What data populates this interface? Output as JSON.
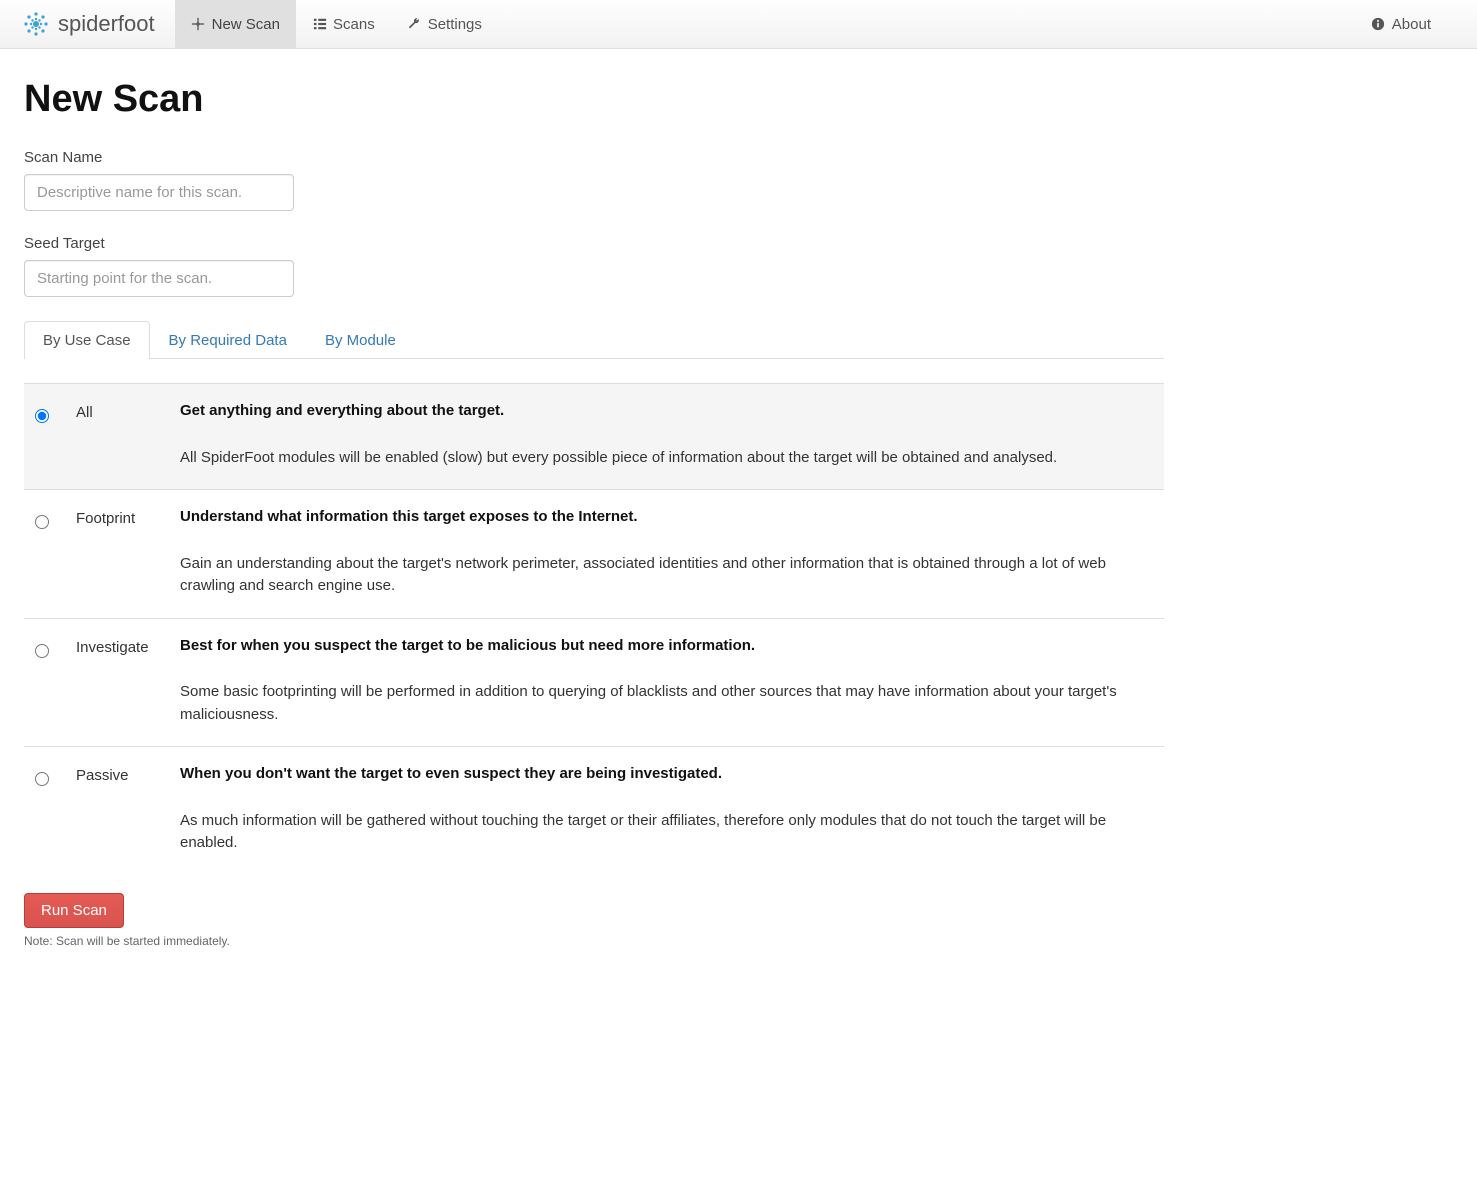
{
  "brand": {
    "name": "spiderfoot"
  },
  "nav": {
    "new_scan": "New Scan",
    "scans": "Scans",
    "settings": "Settings",
    "about": "About"
  },
  "page": {
    "title": "New Scan"
  },
  "form": {
    "scan_name": {
      "label": "Scan Name",
      "placeholder": "Descriptive name for this scan.",
      "value": ""
    },
    "seed_target": {
      "label": "Seed Target",
      "placeholder": "Starting point for the scan.",
      "value": ""
    }
  },
  "tabs": {
    "by_use_case": "By Use Case",
    "by_required_data": "By Required Data",
    "by_module": "By Module",
    "active": "by_use_case"
  },
  "usecases": [
    {
      "id": "all",
      "name": "All",
      "selected": true,
      "short": "Get anything and everything about the target.",
      "long": "All SpiderFoot modules will be enabled (slow) but every possible piece of information about the target will be obtained and analysed."
    },
    {
      "id": "footprint",
      "name": "Footprint",
      "selected": false,
      "short": "Understand what information this target exposes to the Internet.",
      "long": "Gain an understanding about the target's network perimeter, associated identities and other information that is obtained through a lot of web crawling and search engine use."
    },
    {
      "id": "investigate",
      "name": "Investigate",
      "selected": false,
      "short": "Best for when you suspect the target to be malicious but need more information.",
      "long": "Some basic footprinting will be performed in addition to querying of blacklists and other sources that may have information about your target's maliciousness."
    },
    {
      "id": "passive",
      "name": "Passive",
      "selected": false,
      "short": "When you don't want the target to even suspect they are being investigated.",
      "long": "As much information will be gathered without touching the target or their affiliates, therefore only modules that do not touch the target will be enabled."
    }
  ],
  "run_button": "Run Scan",
  "note": "Note: Scan will be started immediately."
}
